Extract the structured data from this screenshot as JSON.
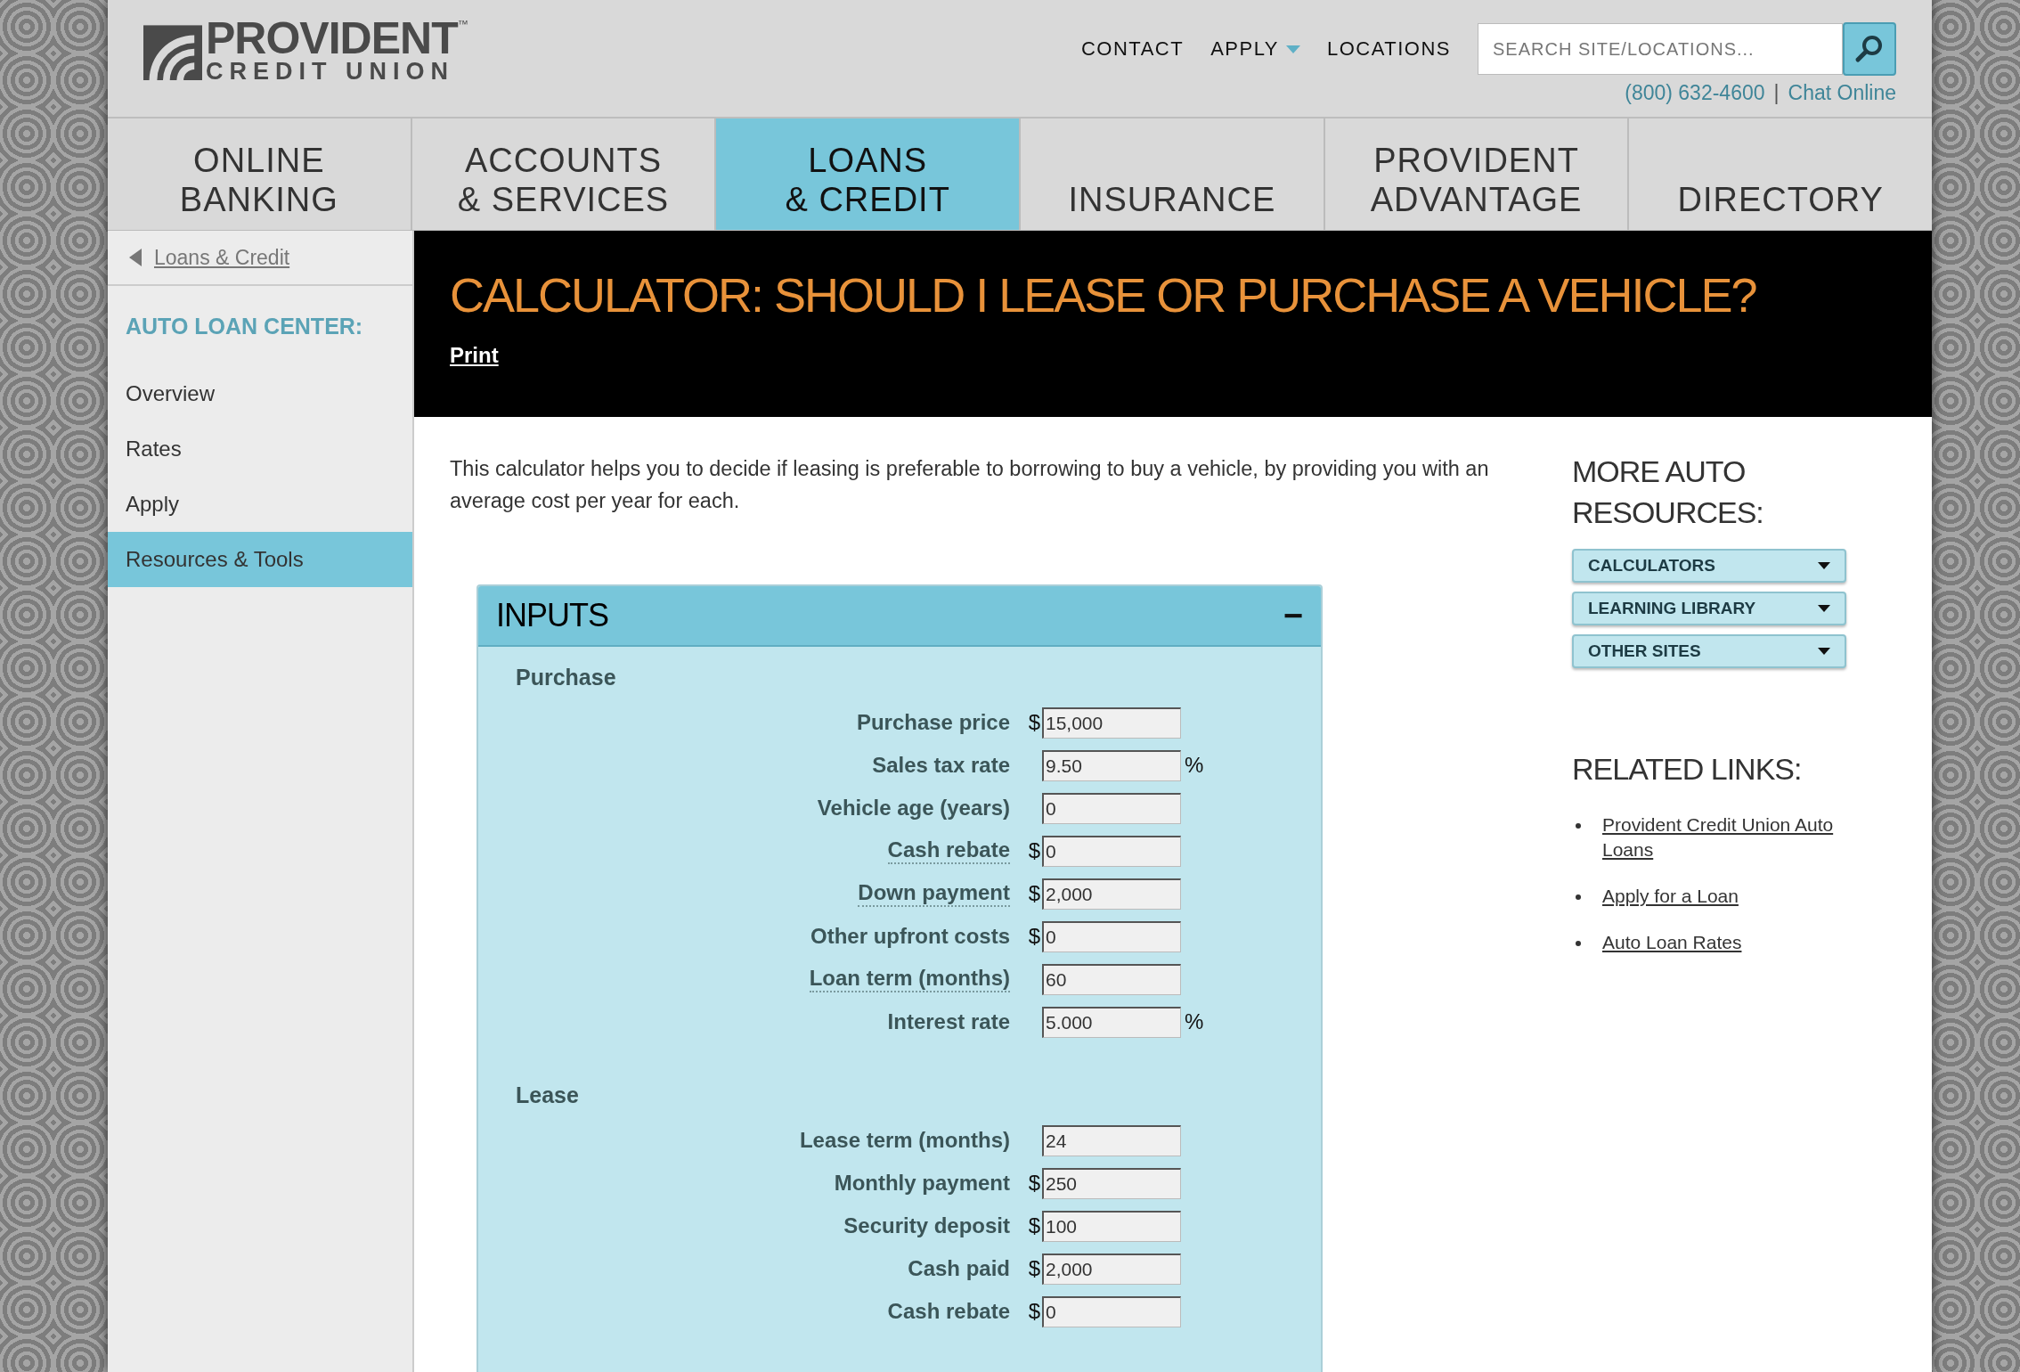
{
  "logo": {
    "name": "PROVIDENT",
    "tm": "™",
    "sub": "CREDIT UNION"
  },
  "top_links": [
    {
      "label": "CONTACT",
      "dropdown": false
    },
    {
      "label": "APPLY",
      "dropdown": true
    },
    {
      "label": "LOCATIONS",
      "dropdown": false
    }
  ],
  "search": {
    "placeholder": "SEARCH SITE/LOCATIONS..."
  },
  "contact": {
    "phone": "(800) 632-4600",
    "separator": "|",
    "chat": "Chat Online"
  },
  "nav": [
    {
      "lines": [
        "ONLINE",
        "BANKING"
      ],
      "selected": false
    },
    {
      "lines": [
        "ACCOUNTS",
        "& SERVICES"
      ],
      "selected": false
    },
    {
      "lines": [
        "LOANS",
        "& CREDIT"
      ],
      "selected": true
    },
    {
      "lines": [
        "INSURANCE"
      ],
      "selected": false
    },
    {
      "lines": [
        "PROVIDENT",
        "ADVANTAGE"
      ],
      "selected": false
    },
    {
      "lines": [
        "DIRECTORY"
      ],
      "selected": false
    }
  ],
  "sidebar": {
    "back": "Loans & Credit",
    "heading": "AUTO LOAN CENTER:",
    "items": [
      {
        "label": "Overview",
        "selected": false
      },
      {
        "label": "Rates",
        "selected": false
      },
      {
        "label": "Apply",
        "selected": false
      },
      {
        "label": "Resources & Tools",
        "selected": true
      }
    ]
  },
  "page": {
    "title": "CALCULATOR: SHOULD I LEASE OR PURCHASE A VEHICLE?",
    "print": "Print",
    "intro": "This calculator helps you to decide if leasing is preferable to borrowing to buy a vehicle, by providing you with an average cost per year for each."
  },
  "inputs": {
    "title": "INPUTS",
    "toggle": "−",
    "sections": [
      {
        "title": "Purchase",
        "fields": [
          {
            "label": "Purchase price",
            "prefix": "$",
            "value": "15,000",
            "has_help": false
          },
          {
            "label": "Sales tax rate",
            "value": "9.50",
            "suffix": "%",
            "has_help": false
          },
          {
            "label": "Vehicle age (years)",
            "value": "0",
            "has_help": false
          },
          {
            "label": "Cash rebate",
            "prefix": "$",
            "value": "0",
            "has_help": true
          },
          {
            "label": "Down payment",
            "prefix": "$",
            "value": "2,000",
            "has_help": true
          },
          {
            "label": "Other upfront costs",
            "prefix": "$",
            "value": "0",
            "has_help": false
          },
          {
            "label": "Loan term (months)",
            "value": "60",
            "has_help": true
          },
          {
            "label": "Interest rate",
            "value": "5.000",
            "suffix": "%",
            "has_help": false
          }
        ]
      },
      {
        "title": "Lease",
        "fields": [
          {
            "label": "Lease term (months)",
            "value": "24",
            "has_help": false
          },
          {
            "label": "Monthly payment",
            "prefix": "$",
            "value": "250",
            "has_help": false
          },
          {
            "label": "Security deposit",
            "prefix": "$",
            "value": "100",
            "has_help": false
          },
          {
            "label": "Cash paid",
            "prefix": "$",
            "value": "2,000",
            "has_help": false
          },
          {
            "label": "Cash rebate",
            "prefix": "$",
            "value": "0",
            "has_help": false
          }
        ]
      }
    ]
  },
  "resources": {
    "title_lines": [
      "MORE AUTO",
      "RESOURCES:"
    ],
    "dropdowns": [
      "CALCULATORS",
      "LEARNING LIBRARY",
      "OTHER SITES"
    ]
  },
  "related": {
    "title": "RELATED LINKS:",
    "links": [
      "Provident Credit Union Auto Loans",
      "Apply for a Loan",
      "Auto Loan Rates"
    ]
  }
}
